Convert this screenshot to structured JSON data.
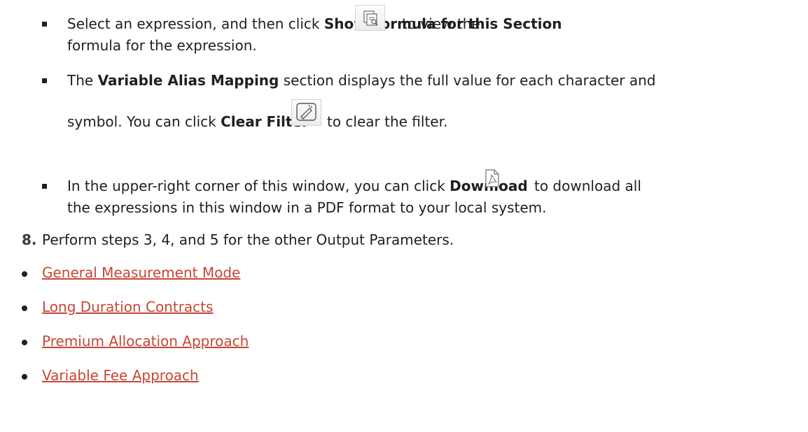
{
  "items": {
    "show_formula": {
      "pre": "Select an expression, and then click ",
      "bold": "Show Formula for this Section",
      "post": "to view the",
      "line2": "formula for the expression."
    },
    "alias_mapping": {
      "pre": "The ",
      "bold": "Variable Alias Mapping",
      "post": " section displays the full value for each character and",
      "line2_pre": "symbol. You can click ",
      "line2_bold": "Clear Filter",
      "line2_post": "to clear the filter."
    },
    "download": {
      "pre": "In the upper-right corner of this window, you can click ",
      "bold": "Download",
      "post": "to download all",
      "line2": "the expressions in this window in a PDF format to your local system."
    }
  },
  "step8": {
    "number": "8.",
    "text": "Perform steps 3, 4, and 5 for the other Output Parameters."
  },
  "links": [
    "General Measurement Mode",
    "Long Duration Contracts",
    "Premium Allocation Approach",
    "Variable Fee Approach"
  ],
  "colors": {
    "link": "#c74634",
    "text": "#1f1f1f"
  },
  "icons": [
    "show-formula-icon",
    "clear-filter-icon",
    "pdf-download-icon"
  ]
}
